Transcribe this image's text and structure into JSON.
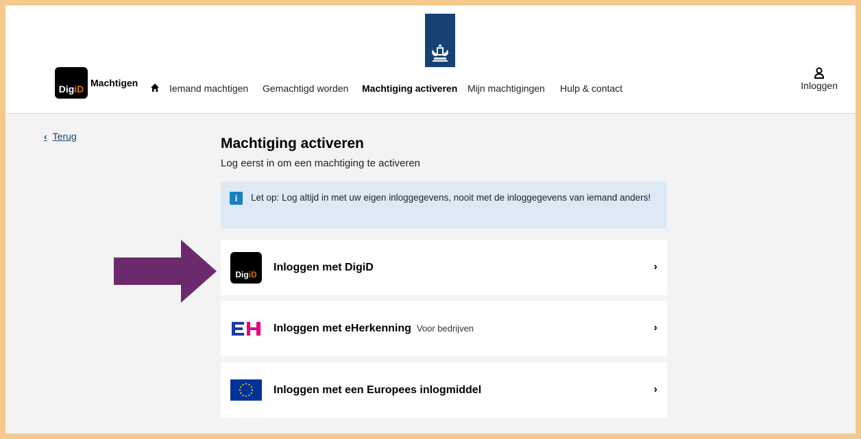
{
  "header": {
    "brand_logo_text_a": "Dig",
    "brand_logo_text_b": "iD",
    "brand_name": "Machtigen",
    "nav": [
      {
        "label": "Iemand machtigen",
        "active": false
      },
      {
        "label": "Gemachtigd worden",
        "active": false
      },
      {
        "label": "Machtiging activeren",
        "active": true
      },
      {
        "label": "Mijn machtigingen",
        "active": false
      },
      {
        "label": "Hulp & contact",
        "active": false
      }
    ],
    "login_label": "Inloggen"
  },
  "back_label": "Terug",
  "main": {
    "title": "Machtiging activeren",
    "subtitle": "Log eerst in om een machtiging te activeren",
    "info_icon": "i",
    "info_text": "Let op: Log altijd in met uw eigen inloggegevens, nooit met de inloggegevens van iemand anders!",
    "options": [
      {
        "label": "Inloggen met DigiD",
        "hint": "",
        "logo_a": "Dig",
        "logo_b": "iD",
        "arrow": "›"
      },
      {
        "label": "Inloggen met eHerkenning",
        "hint": "Voor bedrijven",
        "arrow": "›"
      },
      {
        "label": "Inloggen met een Europees inlogmiddel",
        "hint": "",
        "arrow": "›"
      }
    ]
  },
  "colors": {
    "page_border": "#f5c98e",
    "rijksoverheid_blue": "#154273",
    "digid_orange": "#e17000",
    "info_bg": "#ddeaf6",
    "annotation_arrow": "#6b2a6e",
    "eherkenning_blue": "#1a3ca8",
    "eherkenning_pink": "#e5007d",
    "eu_blue": "#003399",
    "eu_star": "#ffcc00"
  }
}
